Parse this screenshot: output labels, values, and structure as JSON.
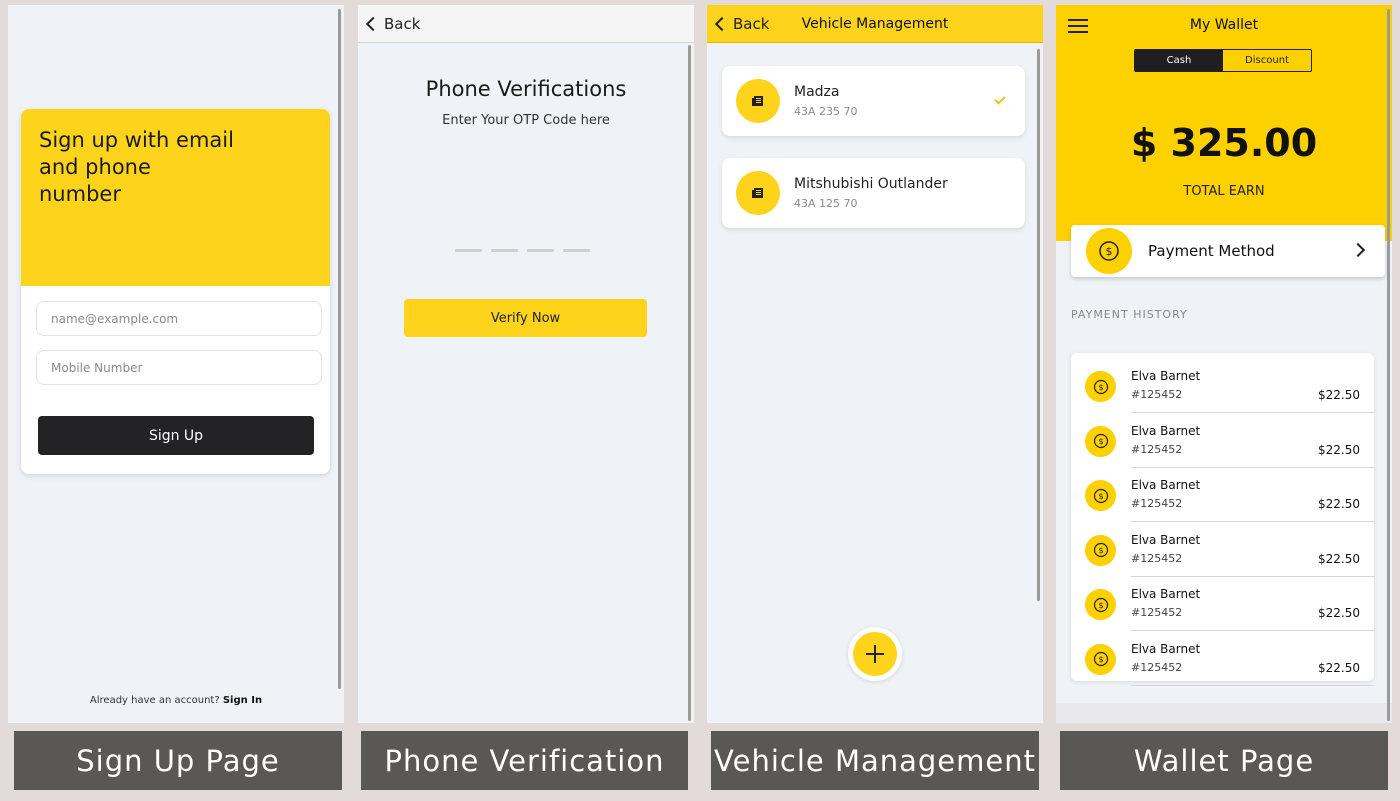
{
  "colors": {
    "accent": "#fdd41b",
    "dark": "#232326",
    "caption_bg": "#5a5757"
  },
  "captions": [
    "Sign Up Page",
    "Phone Verification",
    "Vehicle Management",
    "Wallet Page"
  ],
  "signup": {
    "title": "Sign up with email and phone number",
    "email_placeholder": "name@example.com",
    "mobile_placeholder": "Mobile Number",
    "button": "Sign Up",
    "footer_text": "Already have an account?",
    "footer_link": "Sign In"
  },
  "verify": {
    "back": "Back",
    "title": "Phone Verifications",
    "subtitle": "Enter Your OTP Code here",
    "otp_digits": 4,
    "button": "Verify Now"
  },
  "vehicles": {
    "back": "Back",
    "title": "Vehicle Management",
    "items": [
      {
        "name": "Madza",
        "plate": "43A 235 70",
        "selected": true,
        "icon": "vehicle-doc-icon"
      },
      {
        "name": "Mitshubishi Outlander",
        "plate": "43A 125 70",
        "selected": false,
        "icon": "vehicle-doc-icon"
      }
    ],
    "fab_icon": "plus-icon"
  },
  "wallet": {
    "title": "My Wallet",
    "tabs": [
      {
        "label": "Cash",
        "active": true
      },
      {
        "label": "Discount",
        "active": false
      }
    ],
    "amount": "$ 325.00",
    "amount_label": "TOTAL EARN",
    "payment_method": "Payment Method",
    "history_label": "PAYMENT HISTORY",
    "transactions": [
      {
        "name": "Elva Barnet",
        "id": "#125452",
        "amount": "$22.50"
      },
      {
        "name": "Elva Barnet",
        "id": "#125452",
        "amount": "$22.50"
      },
      {
        "name": "Elva Barnet",
        "id": "#125452",
        "amount": "$22.50"
      },
      {
        "name": "Elva Barnet",
        "id": "#125452",
        "amount": "$22.50"
      },
      {
        "name": "Elva Barnet",
        "id": "#125452",
        "amount": "$22.50"
      },
      {
        "name": "Elva Barnet",
        "id": "#125452",
        "amount": "$22.50"
      }
    ]
  }
}
